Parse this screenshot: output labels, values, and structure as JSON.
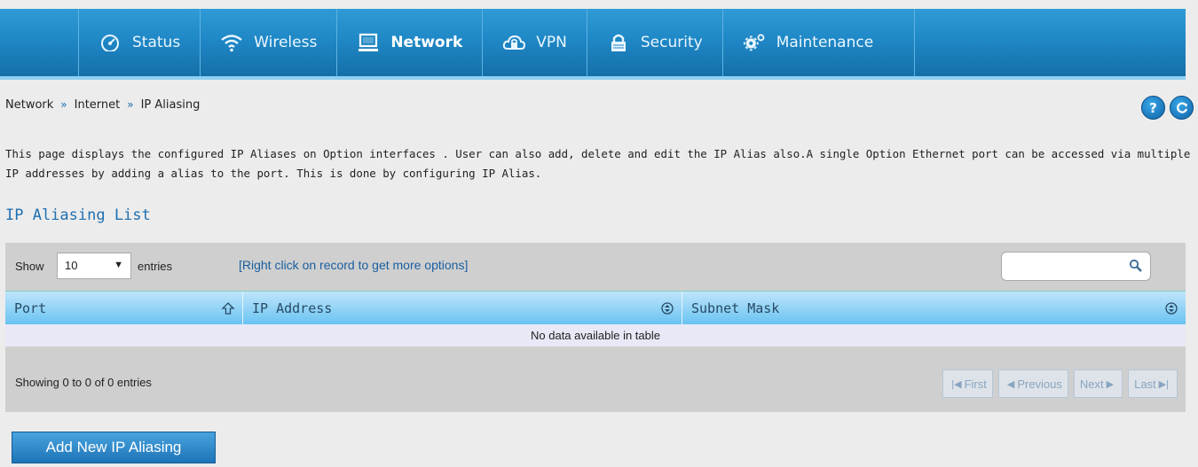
{
  "nav": {
    "items": [
      {
        "label": "Status",
        "icon": "gauge-icon"
      },
      {
        "label": "Wireless",
        "icon": "wifi-icon"
      },
      {
        "label": "Network",
        "icon": "monitor-icon"
      },
      {
        "label": "VPN",
        "icon": "cloud-lock-icon"
      },
      {
        "label": "Security",
        "icon": "lock-icon"
      },
      {
        "label": "Maintenance",
        "icon": "gears-icon"
      }
    ],
    "active": "Network"
  },
  "breadcrumb": [
    "Network",
    "Internet",
    "IP Aliasing"
  ],
  "breadcrumb_sep": "»",
  "help_icon": "?",
  "description": "This page displays the configured IP Aliases on Option interfaces . User can also add, delete and edit the IP Alias also.A single Option Ethernet port can be accessed via multiple IP addresses by adding a alias to the port. This is done by configuring IP Alias.",
  "section_title": "IP Aliasing List",
  "table": {
    "show_label": "Show",
    "page_size": "10",
    "entries_label": "entries",
    "hint": "[Right click on record to get more options]",
    "search_value": "",
    "columns": [
      "Port",
      "IP Address",
      "Subnet Mask"
    ],
    "empty_text": "No data available in table",
    "info": "Showing 0 to 0 of 0 entries",
    "pager": {
      "first": "First",
      "previous": "Previous",
      "next": "Next",
      "last": "Last"
    }
  },
  "add_button": "Add New IP Aliasing",
  "colors": {
    "accent": "#1f88c6",
    "header_row": "#69c3f1",
    "title": "#1f6fb0"
  }
}
